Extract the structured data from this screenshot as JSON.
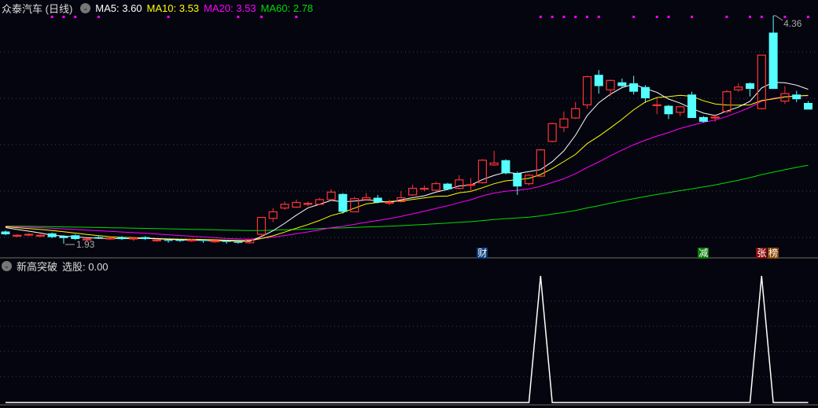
{
  "header": {
    "stock_name": "众泰汽车 (日线)",
    "ma5": "MA5: 3.60",
    "ma10": "MA10: 3.53",
    "ma20": "MA20: 3.53",
    "ma60": "MA60: 2.78"
  },
  "indicator": {
    "name": "新高突破",
    "value": "选股: 0.00"
  },
  "colors": {
    "up": "#ff3333",
    "down": "#55ffff",
    "ma5": "#ffffff",
    "ma10": "#ffff00",
    "ma20": "#ff00ff",
    "ma60": "#00dd00",
    "dot": "#ff00ff"
  },
  "flags": [
    {
      "label": "财",
      "index": 41,
      "color": "#0a3c78"
    },
    {
      "label": "减",
      "index": 60,
      "color": "#0a7a0a"
    },
    {
      "label": "张",
      "index": 65,
      "color": "#8a0a0a"
    },
    {
      "label": "榜",
      "index": 66,
      "color": "#8a4a0a"
    }
  ],
  "chart_data": {
    "type": "candlestick",
    "ylim": [
      1.93,
      4.36
    ],
    "high_label": "4.36",
    "low_label": "1.93",
    "ma_seed": 2.12,
    "signal_dot_indices": [
      4,
      5,
      6,
      8,
      14,
      20,
      22,
      25,
      46,
      47,
      48,
      49,
      50,
      51,
      54,
      56,
      57,
      59,
      62,
      64,
      65,
      67,
      69
    ],
    "candles": [
      [
        2.06,
        2.07,
        2.02,
        2.03
      ],
      [
        2.01,
        2.03,
        2.0,
        2.02
      ],
      [
        2.03,
        2.04,
        2.01,
        2.03
      ],
      [
        2.01,
        2.03,
        2.0,
        2.02
      ],
      [
        2.04,
        2.05,
        1.99,
        2.0
      ],
      [
        2.01,
        2.02,
        1.93,
        1.99
      ],
      [
        2.02,
        2.03,
        1.97,
        1.98
      ],
      [
        1.97,
        1.99,
        1.96,
        1.98
      ],
      [
        2.0,
        2.01,
        1.98,
        1.99
      ],
      [
        1.98,
        2.0,
        1.97,
        1.99
      ],
      [
        2.0,
        2.01,
        1.97,
        1.98
      ],
      [
        1.98,
        2.0,
        1.96,
        1.99
      ],
      [
        2.0,
        2.01,
        1.97,
        1.98
      ],
      [
        1.96,
        1.98,
        1.95,
        1.97
      ],
      [
        1.97,
        1.98,
        1.94,
        1.96
      ],
      [
        1.97,
        1.98,
        1.95,
        1.96
      ],
      [
        1.96,
        1.98,
        1.95,
        1.97
      ],
      [
        1.97,
        1.98,
        1.94,
        1.96
      ],
      [
        1.95,
        1.97,
        1.94,
        1.96
      ],
      [
        1.96,
        1.97,
        1.93,
        1.95
      ],
      [
        1.95,
        1.97,
        1.93,
        1.94
      ],
      [
        1.94,
        1.98,
        1.93,
        1.97
      ],
      [
        2.03,
        2.21,
        2.01,
        2.21
      ],
      [
        2.2,
        2.31,
        2.16,
        2.27
      ],
      [
        2.31,
        2.38,
        2.29,
        2.35
      ],
      [
        2.32,
        2.4,
        2.31,
        2.37
      ],
      [
        2.35,
        2.38,
        2.33,
        2.36
      ],
      [
        2.35,
        2.42,
        2.34,
        2.4
      ],
      [
        2.4,
        2.51,
        2.39,
        2.48
      ],
      [
        2.46,
        2.47,
        2.25,
        2.27
      ],
      [
        2.27,
        2.43,
        2.27,
        2.41
      ],
      [
        2.4,
        2.47,
        2.4,
        2.42
      ],
      [
        2.42,
        2.45,
        2.36,
        2.37
      ],
      [
        2.37,
        2.4,
        2.34,
        2.37
      ],
      [
        2.38,
        2.49,
        2.37,
        2.42
      ],
      [
        2.45,
        2.56,
        2.44,
        2.52
      ],
      [
        2.52,
        2.55,
        2.49,
        2.52
      ],
      [
        2.5,
        2.59,
        2.49,
        2.57
      ],
      [
        2.57,
        2.58,
        2.5,
        2.51
      ],
      [
        2.52,
        2.66,
        2.51,
        2.61
      ],
      [
        2.56,
        2.63,
        2.48,
        2.56
      ],
      [
        2.58,
        2.83,
        2.57,
        2.82
      ],
      [
        2.77,
        2.92,
        2.76,
        2.79
      ],
      [
        2.82,
        2.83,
        2.67,
        2.68
      ],
      [
        2.68,
        2.7,
        2.45,
        2.54
      ],
      [
        2.57,
        2.67,
        2.55,
        2.66
      ],
      [
        2.65,
        2.94,
        2.64,
        2.93
      ],
      [
        3.02,
        3.22,
        3.01,
        3.21
      ],
      [
        3.17,
        3.34,
        3.12,
        3.26
      ],
      [
        3.27,
        3.44,
        3.26,
        3.37
      ],
      [
        3.41,
        3.72,
        3.37,
        3.71
      ],
      [
        3.73,
        3.78,
        3.53,
        3.61
      ],
      [
        3.57,
        3.68,
        3.5,
        3.67
      ],
      [
        3.65,
        3.69,
        3.6,
        3.61
      ],
      [
        3.64,
        3.72,
        3.52,
        3.55
      ],
      [
        3.6,
        3.62,
        3.43,
        3.48
      ],
      [
        3.41,
        3.48,
        3.31,
        3.41
      ],
      [
        3.4,
        3.41,
        3.26,
        3.31
      ],
      [
        3.33,
        3.4,
        3.29,
        3.39
      ],
      [
        3.52,
        3.55,
        3.27,
        3.27
      ],
      [
        3.28,
        3.29,
        3.22,
        3.23
      ],
      [
        3.27,
        3.31,
        3.23,
        3.28
      ],
      [
        3.34,
        3.57,
        3.32,
        3.55
      ],
      [
        3.57,
        3.64,
        3.55,
        3.6
      ],
      [
        3.64,
        3.65,
        3.5,
        3.58
      ],
      [
        3.37,
        3.94,
        3.36,
        3.94
      ],
      [
        4.18,
        4.36,
        3.58,
        3.58
      ],
      [
        3.45,
        3.61,
        3.42,
        3.53
      ],
      [
        3.52,
        3.56,
        3.44,
        3.47
      ],
      [
        3.43,
        3.45,
        3.36,
        3.36
      ]
    ],
    "indicator_series": {
      "name": "新高突破",
      "signal_indices": [
        46,
        65
      ],
      "ylim": [
        0,
        1
      ]
    }
  }
}
